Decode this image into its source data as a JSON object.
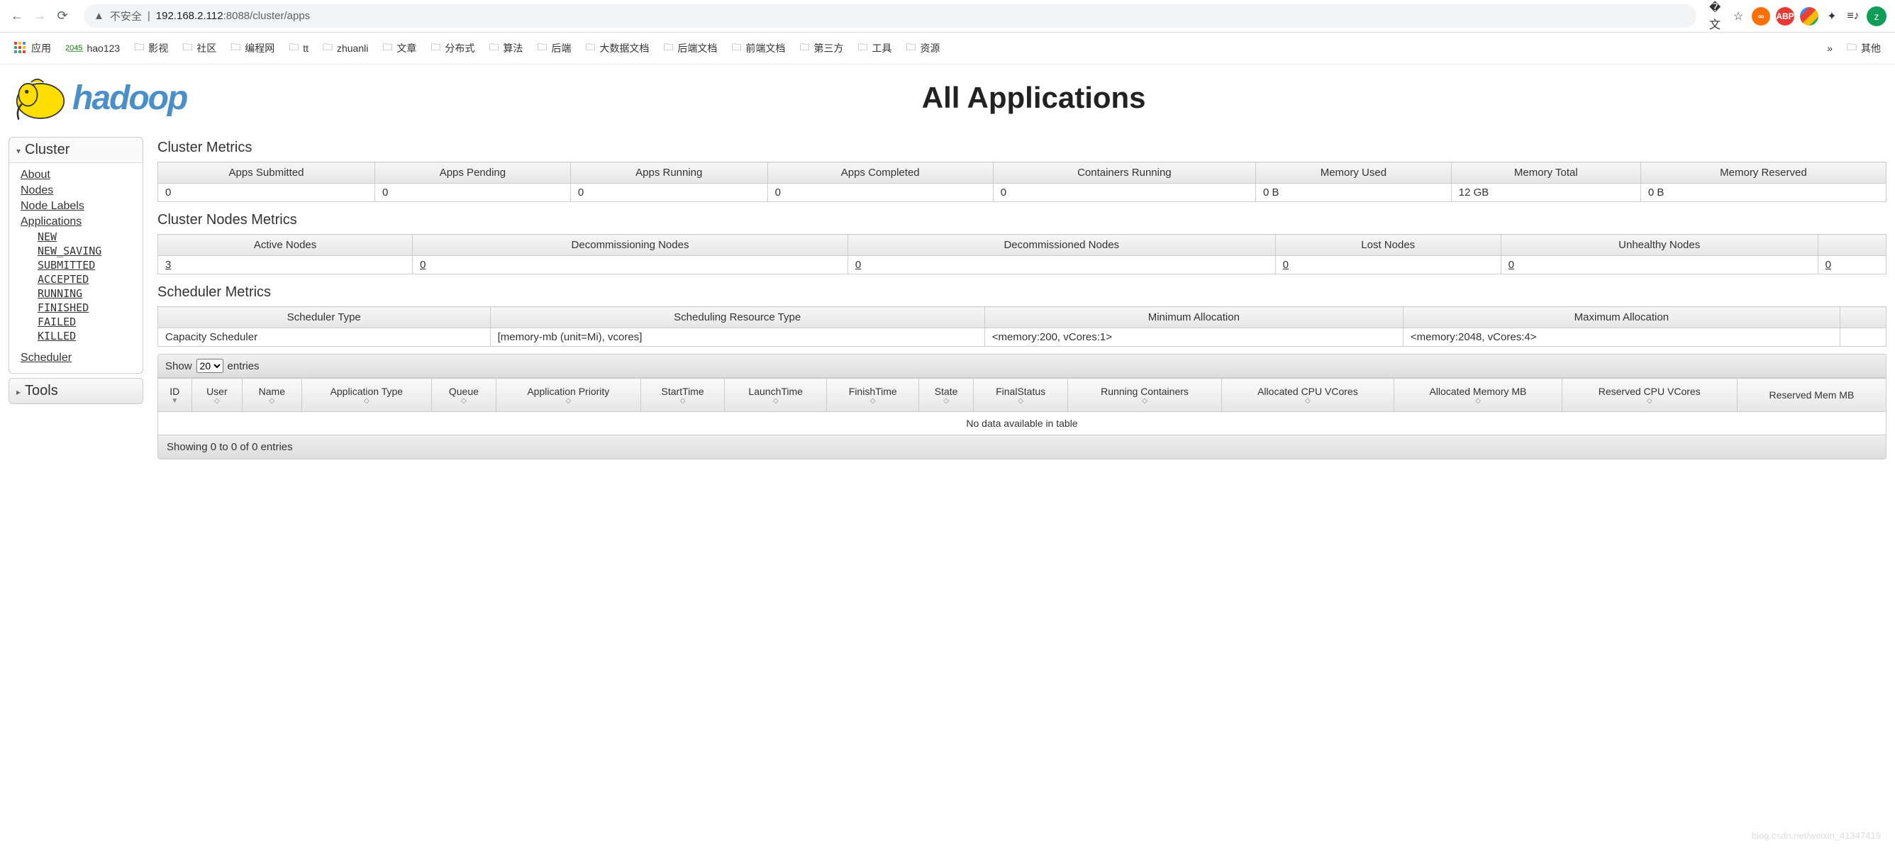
{
  "browser": {
    "warn_label": "不安全",
    "url_ip": "192.168.2.112",
    "url_port": ":8088",
    "url_path": "/cluster/apps",
    "avatar": "z"
  },
  "bookmarks": {
    "apps_label": "应用",
    "items": [
      "hao123",
      "影视",
      "社区",
      "编程网",
      "tt",
      "zhuanli",
      "文章",
      "分布式",
      "算法",
      "后端",
      "大数据文档",
      "后端文档",
      "前端文档",
      "第三方",
      "工具",
      "资源"
    ],
    "overflow": "»",
    "overflow_folder": "其他"
  },
  "header": {
    "logo_text": "hadoop",
    "page_title": "All Applications"
  },
  "sidebar": {
    "cluster_label": "Cluster",
    "tools_label": "Tools",
    "links": {
      "about": "About",
      "nodes": "Nodes",
      "node_labels": "Node Labels",
      "applications": "Applications",
      "scheduler": "Scheduler"
    },
    "app_states": [
      "NEW",
      "NEW_SAVING",
      "SUBMITTED",
      "ACCEPTED",
      "RUNNING",
      "FINISHED",
      "FAILED",
      "KILLED"
    ]
  },
  "cluster_metrics": {
    "title": "Cluster Metrics",
    "headers": [
      "Apps Submitted",
      "Apps Pending",
      "Apps Running",
      "Apps Completed",
      "Containers Running",
      "Memory Used",
      "Memory Total",
      "Memory Reserved"
    ],
    "values": [
      "0",
      "0",
      "0",
      "0",
      "0",
      "0 B",
      "12 GB",
      "0 B"
    ]
  },
  "nodes_metrics": {
    "title": "Cluster Nodes Metrics",
    "headers": [
      "Active Nodes",
      "Decommissioning Nodes",
      "Decommissioned Nodes",
      "Lost Nodes",
      "Unhealthy Nodes",
      ""
    ],
    "values": [
      "3",
      "0",
      "0",
      "0",
      "0",
      "0"
    ]
  },
  "scheduler_metrics": {
    "title": "Scheduler Metrics",
    "headers": [
      "Scheduler Type",
      "Scheduling Resource Type",
      "Minimum Allocation",
      "Maximum Allocation",
      ""
    ],
    "values": [
      "Capacity Scheduler",
      "[memory-mb (unit=Mi), vcores]",
      "<memory:200, vCores:1>",
      "<memory:2048, vCores:4>",
      ""
    ]
  },
  "apps_table": {
    "show_label": "Show",
    "entries_label": "entries",
    "entries_value": "20",
    "columns": [
      "ID",
      "User",
      "Name",
      "Application Type",
      "Queue",
      "Application Priority",
      "StartTime",
      "LaunchTime",
      "FinishTime",
      "State",
      "FinalStatus",
      "Running Containers",
      "Allocated CPU VCores",
      "Allocated Memory MB",
      "Reserved CPU VCores",
      "Reserved Mem MB"
    ],
    "empty_text": "No data available in table",
    "footer": "Showing 0 to 0 of 0 entries"
  },
  "watermark": "blog.csdn.net/weixin_41347419"
}
